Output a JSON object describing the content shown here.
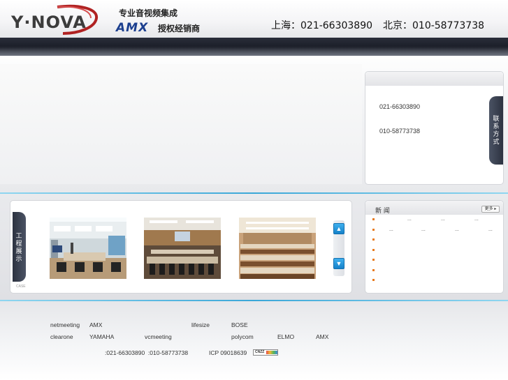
{
  "header": {
    "logo_text": "Y·NOVA",
    "tagline": "专业音视频集成",
    "amx_logo": "AMX",
    "dealer": "授权经销商",
    "phone_shanghai": "上海：021-66303890",
    "phone_beijing": "北京：010-58773738"
  },
  "contact": {
    "phone1": "021-66303890",
    "phone2": "010-58773738",
    "tab_label": "联系方式"
  },
  "cases": {
    "tab_label": "工程展示",
    "small_label": "CASE",
    "scroll_up_icon": "arrow-up-icon",
    "scroll_down_icon": "arrow-down-icon"
  },
  "news": {
    "title": "新 闻",
    "more_label": "更多 ▸",
    "items": [
      {
        "dots": [
          "...",
          "...",
          "..."
        ]
      },
      {
        "dots": [
          "...",
          "...",
          "...",
          "..."
        ]
      },
      {
        "dots": []
      },
      {
        "dots": []
      },
      {
        "dots": []
      },
      {
        "dots": []
      },
      {
        "dots": []
      }
    ]
  },
  "footer": {
    "row1": [
      "netmeeting",
      "AMX",
      "lifesize",
      "BOSE"
    ],
    "row2": [
      "clearone",
      "YAMAHA",
      "vcmeeting",
      "polycom",
      "ELMO",
      "AMX"
    ],
    "phones": ":021-66303890  :010-58773738",
    "icp": "ICP 09018639",
    "cnzz_label": "CNZZ"
  },
  "colors": {
    "accent_blue": "#3aa7d8",
    "nav_dark": "#1a1d27",
    "bullet_orange": "#e87a1c",
    "amx_blue": "#1c3f8f"
  }
}
